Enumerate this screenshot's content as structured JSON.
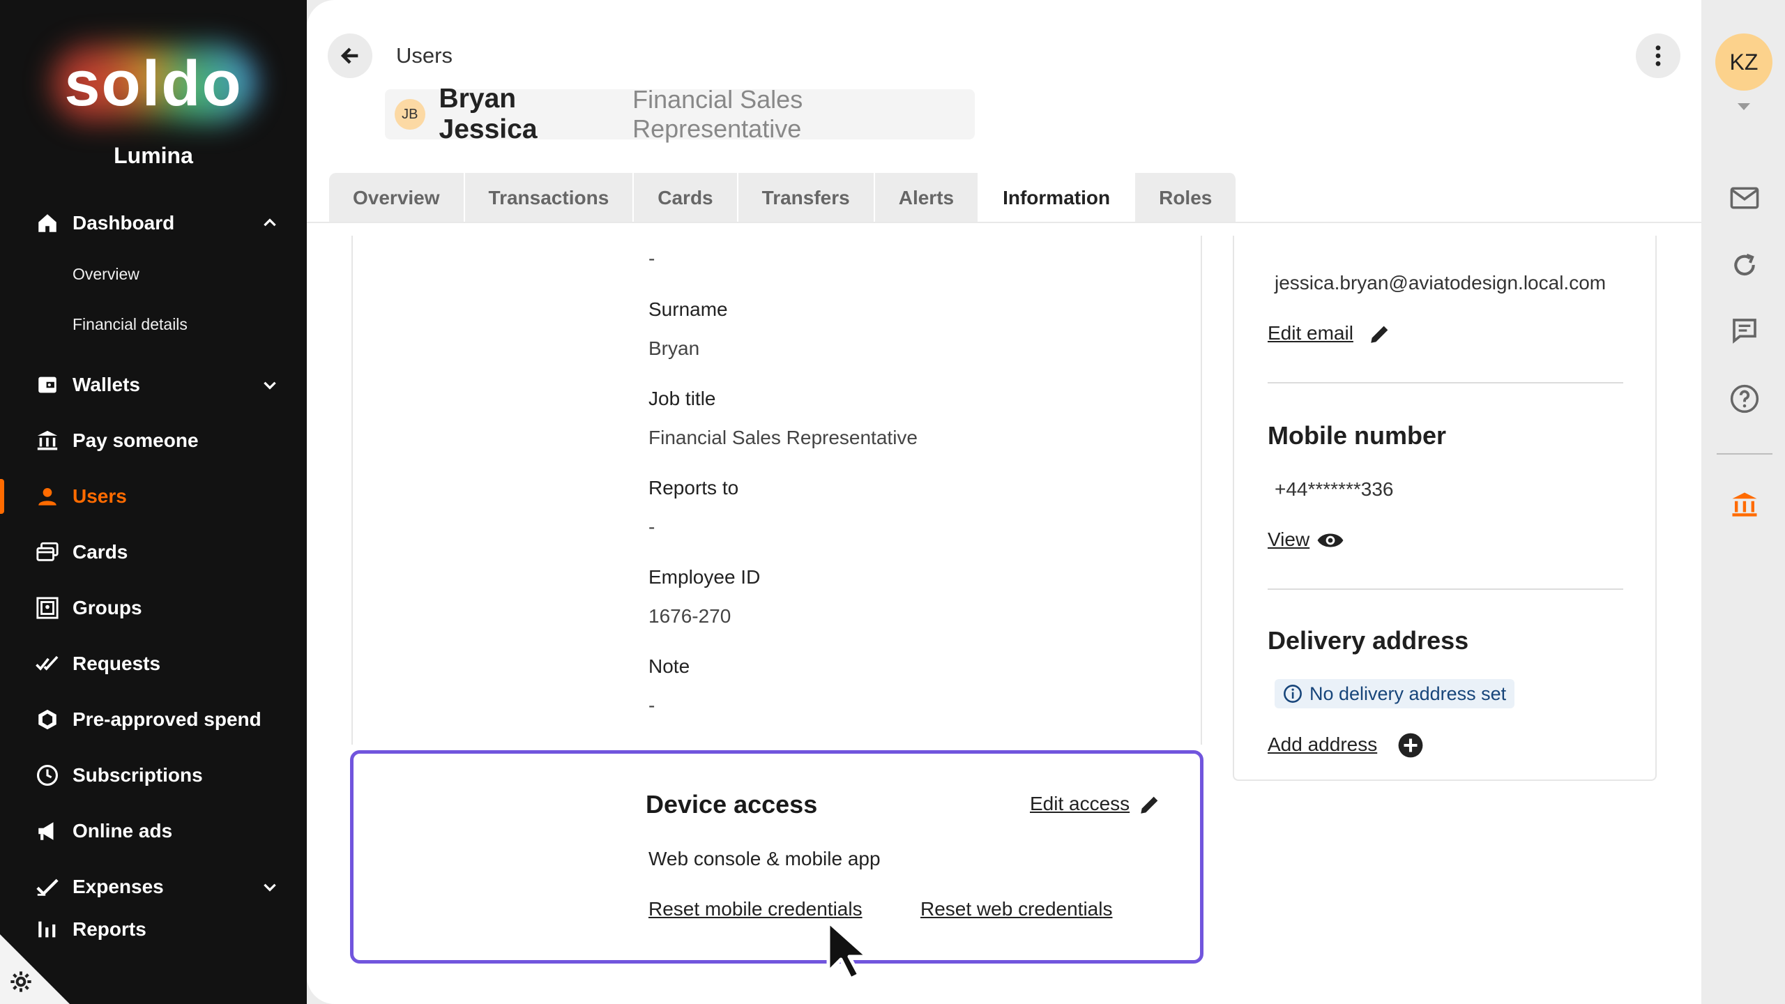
{
  "brand": {
    "logo_text": "soldo",
    "company": "Lumina"
  },
  "sidebar": {
    "items": [
      {
        "label": "Dashboard",
        "icon": "home-icon"
      },
      {
        "label": "Wallets",
        "icon": "wallet-icon"
      },
      {
        "label": "Pay someone",
        "icon": "bank-transfer-icon"
      },
      {
        "label": "Users",
        "icon": "user-icon"
      },
      {
        "label": "Cards",
        "icon": "cards-icon"
      },
      {
        "label": "Groups",
        "icon": "groups-icon"
      },
      {
        "label": "Requests",
        "icon": "double-check-icon"
      },
      {
        "label": "Pre-approved spend",
        "icon": "hexagon-icon"
      },
      {
        "label": "Subscriptions",
        "icon": "clock-icon"
      },
      {
        "label": "Online ads",
        "icon": "megaphone-icon"
      },
      {
        "label": "Expenses",
        "icon": "check-icon"
      },
      {
        "label": "Reports",
        "icon": "bar-chart-icon"
      }
    ],
    "dashboard_sub": [
      "Overview",
      "Financial details"
    ],
    "active": "Users"
  },
  "header": {
    "breadcrumb": "Users",
    "user_initials": "JB",
    "user_name": "Bryan Jessica",
    "user_role": "Financial Sales Representative"
  },
  "tabs": [
    "Overview",
    "Transactions",
    "Cards",
    "Transfers",
    "Alerts",
    "Information",
    "Roles"
  ],
  "active_tab": "Information",
  "details": {
    "top_value": "-",
    "surname_label": "Surname",
    "surname": "Bryan",
    "job_title_label": "Job title",
    "job_title": "Financial Sales Representative",
    "reports_to_label": "Reports to",
    "reports_to": "-",
    "employee_id_label": "Employee ID",
    "employee_id": "1676-270",
    "note_label": "Note",
    "note": "-"
  },
  "device_access": {
    "title": "Device access",
    "edit_label": "Edit access",
    "value": "Web console & mobile app",
    "reset_mobile": "Reset mobile credentials",
    "reset_web": "Reset web credentials"
  },
  "contact": {
    "email": "jessica.bryan@aviatodesign.local.com",
    "edit_email": "Edit email",
    "mobile_title": "Mobile number",
    "mobile": "+44*******336",
    "view_label": "View",
    "delivery_title": "Delivery address",
    "no_address": "No delivery address set",
    "add_address": "Add address"
  },
  "rail": {
    "initials": "KZ"
  },
  "colors": {
    "accent": "#ff6b00",
    "highlight": "#7155dd",
    "sidebar_bg": "#121212"
  }
}
